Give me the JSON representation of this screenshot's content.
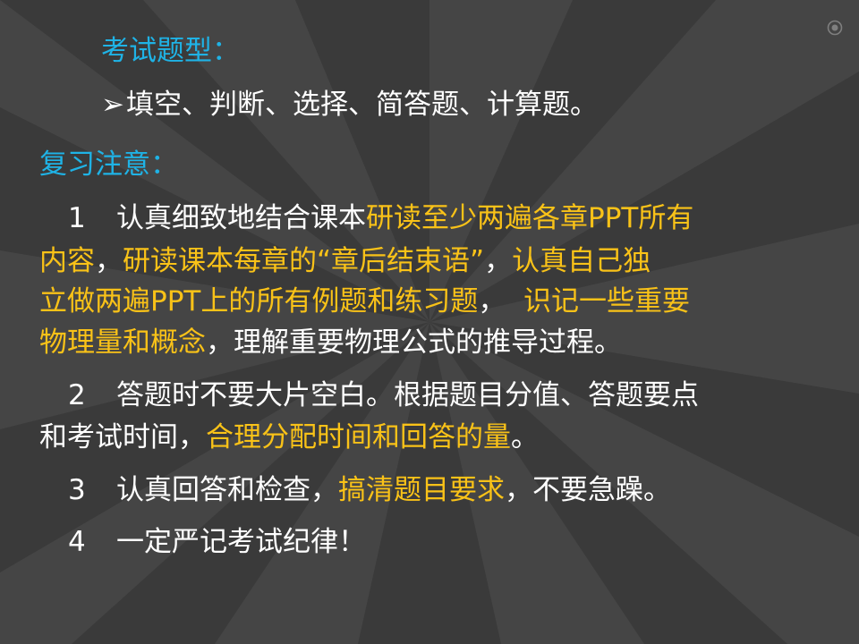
{
  "exam_type": {
    "heading": "考试题型：",
    "bullet_glyph": "➢",
    "items_text": "填空、判断、选择、简答题、计算题。"
  },
  "review": {
    "heading": "复习注意：",
    "points": [
      {
        "num": "1",
        "lines": [
          [
            {
              "t": "认真细致地结合课本",
              "hl": false
            },
            {
              "t": "研读至少两遍各章PPT所有",
              "hl": true
            }
          ],
          [
            {
              "t": "内容",
              "hl": true
            },
            {
              "t": "，",
              "hl": false
            },
            {
              "t": "研读课本每章的“章后结束语”",
              "hl": true
            },
            {
              "t": "，",
              "hl": false
            },
            {
              "t": "认真自己独",
              "hl": true
            }
          ],
          [
            {
              "t": "立做两遍PPT上的所有例题和练习题",
              "hl": true
            },
            {
              "t": "，  ",
              "hl": false
            },
            {
              "t": "识记一些重要",
              "hl": true
            }
          ],
          [
            {
              "t": "物理量和概念",
              "hl": true
            },
            {
              "t": "，理解重要物理公式的推导过程。",
              "hl": false
            }
          ]
        ]
      },
      {
        "num": "2",
        "lines": [
          [
            {
              "t": "答题时不要大片空白。根据题目分值、答题要点",
              "hl": false
            }
          ],
          [
            {
              "t": "和考试时间，",
              "hl": false
            },
            {
              "t": "合理分配时间和回答的量",
              "hl": true
            },
            {
              "t": "。",
              "hl": false
            }
          ]
        ]
      },
      {
        "num": "3",
        "lines": [
          [
            {
              "t": "认真回答和检查，",
              "hl": false
            },
            {
              "t": "搞清题目要求",
              "hl": true
            },
            {
              "t": "，不要急躁。",
              "hl": false
            }
          ]
        ]
      },
      {
        "num": "4",
        "lines": [
          [
            {
              "t": "一定严记考试纪律！",
              "hl": false
            }
          ]
        ]
      }
    ]
  },
  "colors": {
    "background": "#454545",
    "ray": "#3a3a3a",
    "heading": "#1fb3e6",
    "highlight": "#f9c218",
    "text": "#ffffff"
  }
}
